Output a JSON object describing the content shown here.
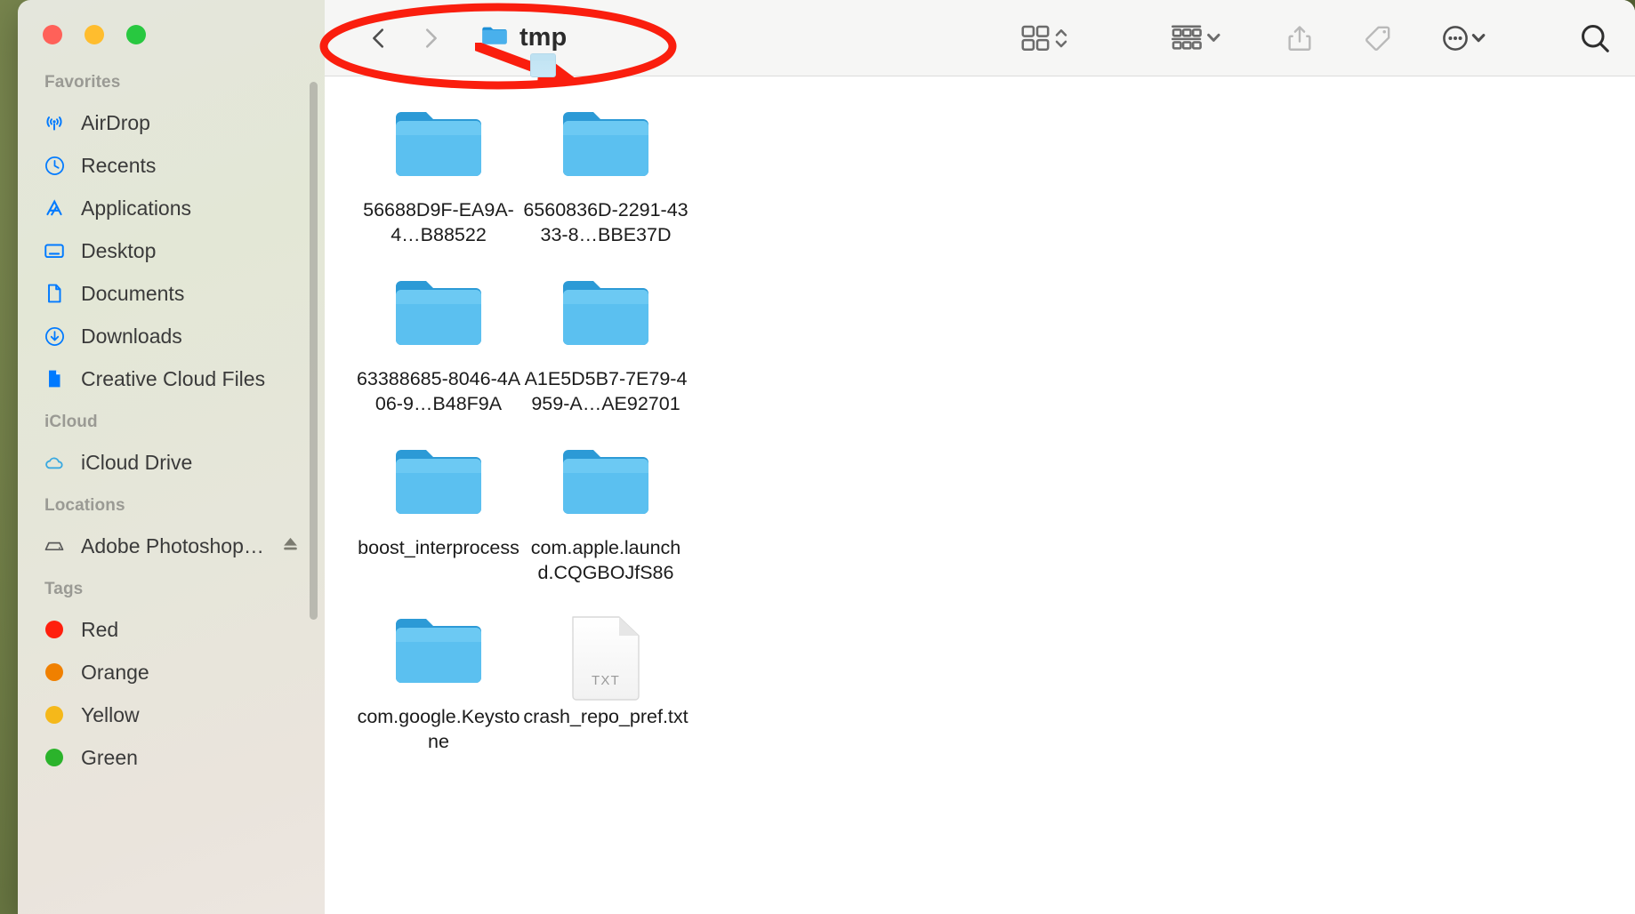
{
  "window": {
    "traffic_lights": [
      {
        "name": "close",
        "color": "#ff6159"
      },
      {
        "name": "minimize",
        "color": "#ffbd2e"
      },
      {
        "name": "fullscreen",
        "color": "#28c840"
      }
    ]
  },
  "toolbar": {
    "back_label": "Back",
    "forward_label": "Forward",
    "title": "tmp",
    "folder_icon": "folder-icon",
    "view_icon": "icon-view-icon",
    "view_sort_chevrons": "chevron-up-down-icon",
    "group_icon": "group-by-icon",
    "group_chevron": "chevron-down-icon",
    "share_icon": "share-icon",
    "tag_icon": "tag-icon",
    "more_icon": "ellipsis-circle-icon",
    "more_chevron": "chevron-down-icon",
    "search_icon": "search-icon"
  },
  "sidebar": {
    "sections": [
      {
        "title": "Favorites",
        "items": [
          {
            "label": "AirDrop",
            "icon": "airdrop-icon",
            "color": "#007aff"
          },
          {
            "label": "Recents",
            "icon": "clock-icon",
            "color": "#007aff"
          },
          {
            "label": "Applications",
            "icon": "applications-icon",
            "color": "#007aff"
          },
          {
            "label": "Desktop",
            "icon": "desktop-icon",
            "color": "#007aff"
          },
          {
            "label": "Documents",
            "icon": "document-icon",
            "color": "#007aff"
          },
          {
            "label": "Downloads",
            "icon": "downloads-icon",
            "color": "#007aff"
          },
          {
            "label": "Creative Cloud Files",
            "icon": "creative-cloud-file-icon",
            "color": "#007aff"
          }
        ]
      },
      {
        "title": "iCloud",
        "items": [
          {
            "label": "iCloud Drive",
            "icon": "cloud-icon",
            "color": "#3aa9e0"
          }
        ]
      },
      {
        "title": "Locations",
        "items": [
          {
            "label": "Adobe Photoshop…",
            "icon": "disk-icon",
            "color": "#5a5a5a",
            "eject": true,
            "eject_icon": "eject-icon"
          }
        ]
      },
      {
        "title": "Tags",
        "items": [
          {
            "label": "Red",
            "icon": "tag-dot-icon",
            "color": "#ff1f0d"
          },
          {
            "label": "Orange",
            "icon": "tag-dot-icon",
            "color": "#f08000"
          },
          {
            "label": "Yellow",
            "icon": "tag-dot-icon",
            "color": "#f5b81a"
          },
          {
            "label": "Green",
            "icon": "tag-dot-icon",
            "color": "#2bb32b"
          }
        ]
      }
    ]
  },
  "files": [
    {
      "name": "56688D9F-EA9A-4…B88522",
      "kind": "folder"
    },
    {
      "name": "6560836D-2291-4333-8…BBE37D",
      "kind": "folder"
    },
    {
      "name": "63388685-8046-4A06-9…B48F9A",
      "kind": "folder"
    },
    {
      "name": "A1E5D5B7-7E79-4959-A…AE92701",
      "kind": "folder"
    },
    {
      "name": "boost_interprocess",
      "kind": "folder"
    },
    {
      "name": "com.apple.launchd.CQGBOJfS86",
      "kind": "folder"
    },
    {
      "name": "com.google.Keystone",
      "kind": "folder"
    },
    {
      "name": "crash_repo_pref.txt",
      "kind": "document",
      "badge": "TXT"
    }
  ],
  "annotations": {
    "highlight_color": "#fa1e0e",
    "ellipse_name": "red-ellipse-highlight",
    "arrow_name": "red-arrow-pointer"
  }
}
